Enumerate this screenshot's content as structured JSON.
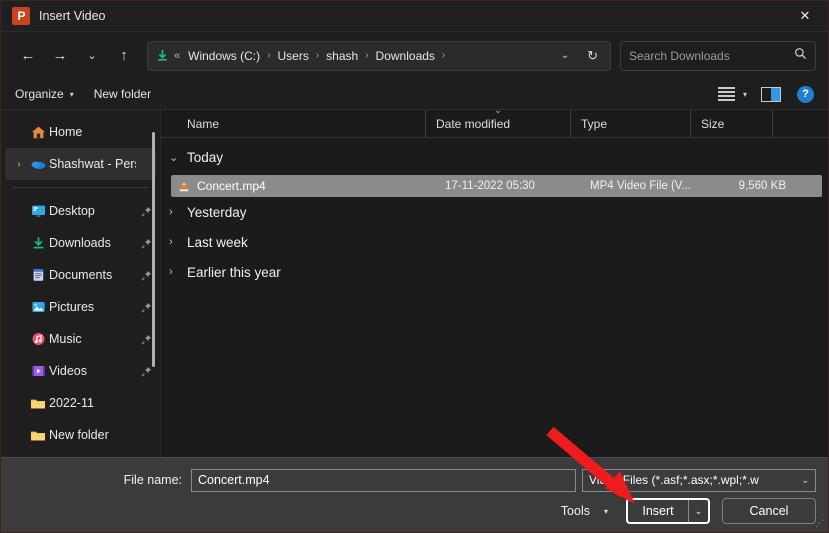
{
  "window": {
    "title": "Insert Video",
    "app_icon": "powerpoint-icon",
    "close_label": "✕",
    "accent_color": "#c8431f"
  },
  "nav": {
    "back_label": "←",
    "forward_label": "→",
    "recent_label": "⌄",
    "up_label": "↑",
    "refresh_label": "↻",
    "dropdown_label": "⌄",
    "path_icon": "downloads-icon",
    "overflow_label": "«",
    "breadcrumbs": [
      "Windows (C:)",
      "Users",
      "shash",
      "Downloads"
    ],
    "separator": "›"
  },
  "search": {
    "placeholder": "Search Downloads",
    "icon": "search-icon"
  },
  "commandbar": {
    "organize_label": "Organize",
    "new_folder_label": "New folder",
    "caret": "▾",
    "view_icon": "view-layout-icon",
    "pane_icon": "preview-pane-icon",
    "help_label": "?"
  },
  "sidebar": {
    "items": [
      {
        "label": "Home",
        "icon": "home-icon",
        "expandable": false,
        "pinned": false,
        "highlighted": false
      },
      {
        "label": "Shashwat - Pers",
        "icon": "onedrive-icon",
        "expandable": true,
        "pinned": false,
        "highlighted": true
      },
      {
        "label": "Desktop",
        "icon": "desktop-icon",
        "expandable": false,
        "pinned": true,
        "highlighted": false
      },
      {
        "label": "Downloads",
        "icon": "downloads-icon",
        "expandable": false,
        "pinned": true,
        "highlighted": false
      },
      {
        "label": "Documents",
        "icon": "documents-icon",
        "expandable": false,
        "pinned": true,
        "highlighted": false
      },
      {
        "label": "Pictures",
        "icon": "pictures-icon",
        "expandable": false,
        "pinned": true,
        "highlighted": false
      },
      {
        "label": "Music",
        "icon": "music-icon",
        "expandable": false,
        "pinned": true,
        "highlighted": false
      },
      {
        "label": "Videos",
        "icon": "videos-icon",
        "expandable": false,
        "pinned": true,
        "highlighted": false
      },
      {
        "label": "2022-11",
        "icon": "folder-icon",
        "expandable": false,
        "pinned": false,
        "highlighted": false
      },
      {
        "label": "New folder",
        "icon": "folder-icon",
        "expandable": false,
        "pinned": false,
        "highlighted": false
      }
    ],
    "pin_glyph": "📌",
    "expand_glyph": "›"
  },
  "filelist": {
    "columns": [
      "Name",
      "Date modified",
      "Type",
      "Size"
    ],
    "sort_indicator": "⌄",
    "groups": [
      {
        "label": "Today",
        "expanded": true,
        "caret": "⌄"
      },
      {
        "label": "Yesterday",
        "expanded": false,
        "caret": "›"
      },
      {
        "label": "Last week",
        "expanded": false,
        "caret": "›"
      },
      {
        "label": "Earlier this year",
        "expanded": false,
        "caret": "›"
      }
    ],
    "files": [
      {
        "name": "Concert.mp4",
        "date_modified": "17-11-2022 05:30",
        "type": "MP4 Video File (V...",
        "size": "9,560 KB",
        "icon": "vlc-media-icon",
        "selected": true
      }
    ]
  },
  "bottom": {
    "file_name_label": "File name:",
    "file_name_value": "Concert.mp4",
    "filter_value": "Video Files (*.asf;*.asx;*.wpl;*.w",
    "filter_caret": "⌄",
    "tools_label": "Tools",
    "tools_caret": "▾",
    "insert_label": "Insert",
    "insert_caret": "⌄",
    "cancel_label": "Cancel",
    "resize_grip": "⋰"
  },
  "annotation": {
    "arrow_color": "#ee1c1c",
    "points_to": "insert-button"
  }
}
